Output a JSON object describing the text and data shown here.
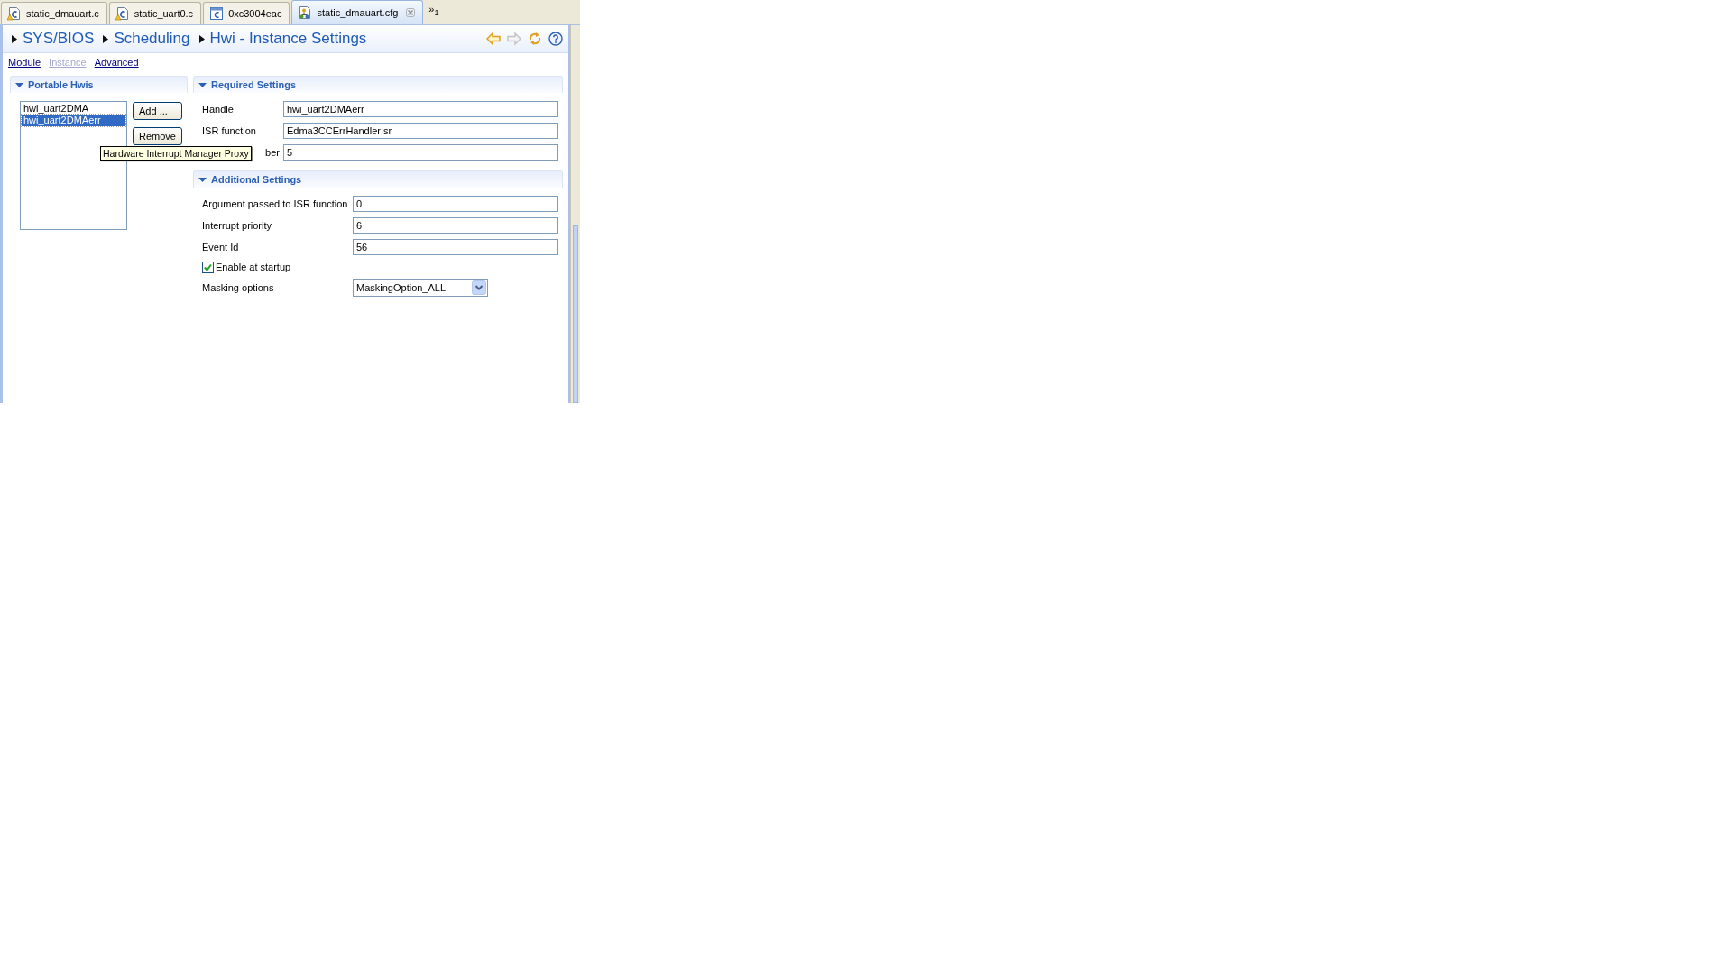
{
  "tabs": [
    {
      "label": "static_dmauart.c",
      "kind": "c-warning",
      "selected": false
    },
    {
      "label": "static_uart0.c",
      "kind": "c-warning",
      "selected": false
    },
    {
      "label": "0xc3004eac",
      "kind": "c",
      "selected": false
    },
    {
      "label": "static_dmauart.cfg",
      "kind": "cfg",
      "selected": true
    }
  ],
  "tab_overflow": {
    "glyph": "»",
    "count": "1"
  },
  "breadcrumb": [
    "SYS/BIOS",
    "Scheduling",
    "Hwi - Instance Settings"
  ],
  "toolbar": [
    {
      "kind": "back",
      "disabled": false
    },
    {
      "kind": "forward",
      "disabled": true
    },
    {
      "kind": "sync",
      "disabled": false
    },
    {
      "kind": "help",
      "disabled": false
    }
  ],
  "links": [
    {
      "label": "Module",
      "disabled": false
    },
    {
      "label": "Instance",
      "disabled": true
    },
    {
      "label": "Advanced",
      "disabled": false
    }
  ],
  "portable_hwis": {
    "title": "Portable Hwis",
    "expanded": true,
    "items": [
      {
        "label": "hwi_uart2DMA",
        "selected": false
      },
      {
        "label": "hwi_uart2DMAerr",
        "selected": true
      }
    ],
    "buttons": [
      "Add ...",
      "Remove"
    ]
  },
  "required_settings": {
    "title": "Required Settings",
    "expanded": true,
    "fields": [
      {
        "label": "Handle",
        "value": "hwi_uart2DMAerr",
        "covered": false
      },
      {
        "label": "ISR function",
        "value": "Edma3CCErrHandlerIsr",
        "covered": false
      },
      {
        "label": "ber",
        "value": "5",
        "covered": true
      }
    ]
  },
  "additional_settings": {
    "title": "Additional Settings",
    "expanded": true,
    "rows": [
      {
        "kind": "text",
        "label": "Argument passed to ISR function",
        "value": "0"
      },
      {
        "kind": "text",
        "label": "Interrupt priority",
        "value": "6"
      },
      {
        "kind": "text",
        "label": "Event Id",
        "value": "56"
      },
      {
        "kind": "checkbox",
        "label": "Enable at startup",
        "checked": true
      },
      {
        "kind": "select",
        "label": "Masking options",
        "value": "MaskingOption_ALL"
      }
    ]
  },
  "tooltip": {
    "text": "Hardware Interrupt Manager Proxy"
  }
}
